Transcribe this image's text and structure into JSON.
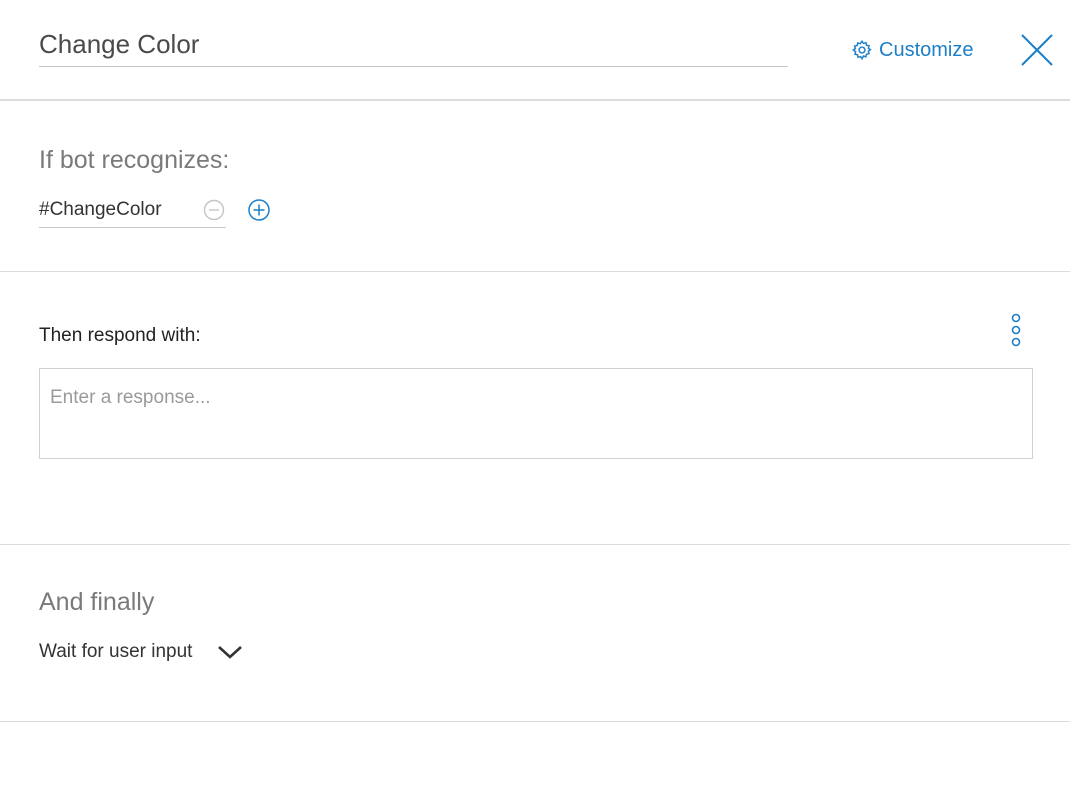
{
  "header": {
    "title_value": "Change Color",
    "customize_label": "Customize",
    "customize_icon": "gear-icon",
    "close_icon": "close-icon"
  },
  "recognize": {
    "heading": "If bot recognizes:",
    "condition_value": "#ChangeColor",
    "remove_icon": "minus-circle-icon",
    "add_icon": "plus-circle-icon"
  },
  "respond": {
    "label": "Then respond with:",
    "placeholder": "Enter a response...",
    "options_icon": "more-vertical-icon"
  },
  "finally": {
    "heading": "And finally",
    "selected_action": "Wait for user input",
    "dropdown_icon": "chevron-down-icon"
  },
  "colors": {
    "accent": "#1d7fc7",
    "border": "#dcdcdc",
    "muted_text": "#7a7a7a"
  }
}
